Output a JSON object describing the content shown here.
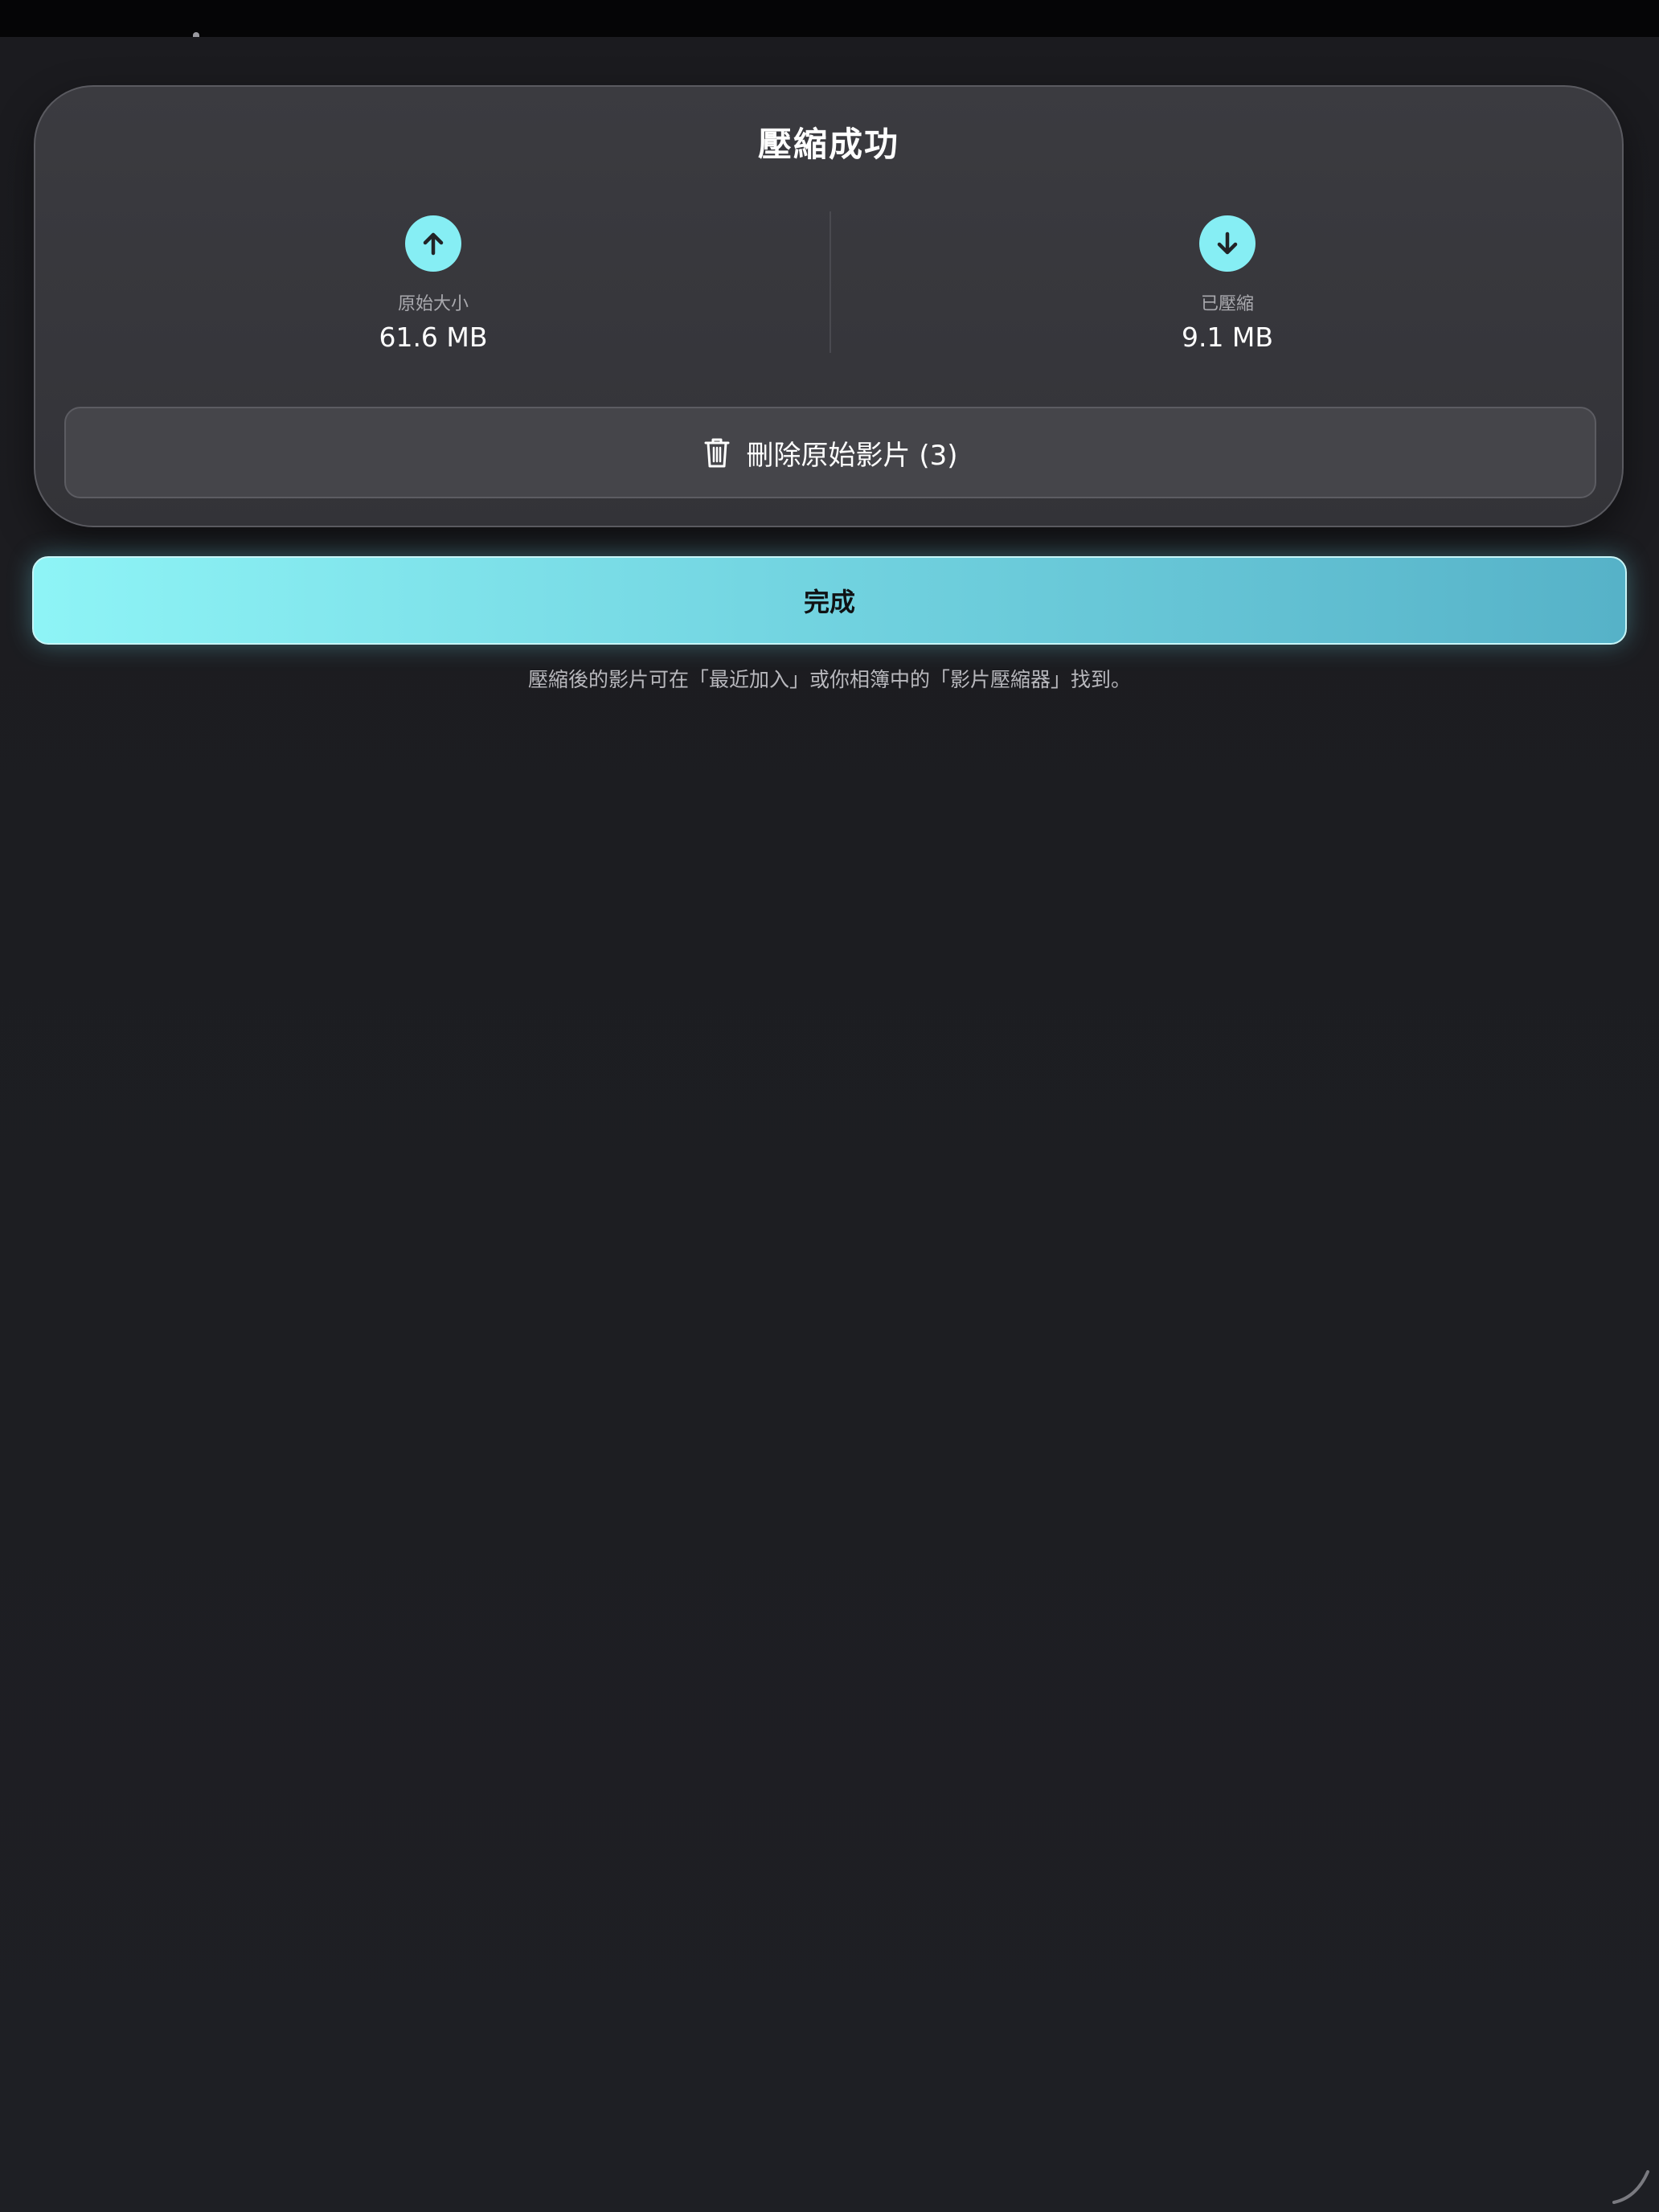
{
  "result": {
    "title": "壓縮成功",
    "original": {
      "label": "原始大小",
      "value": "61.6 MB",
      "icon": "arrow-up-circle-icon"
    },
    "compressed": {
      "label": "已壓縮",
      "value": "9.1 MB",
      "icon": "arrow-down-circle-icon"
    },
    "delete_label": "刪除原始影片 (3)",
    "delete_icon": "trash-icon"
  },
  "done_label": "完成",
  "hint": "壓縮後的影片可在「最近加入」或你相簿中的「影片壓縮器」找到。",
  "colors": {
    "accent": "#86eef4",
    "card_bg": "#38383d",
    "page_bg": "#1c1c20",
    "done_gradient_start": "#8ef4f6",
    "done_gradient_end": "#56b2c8"
  }
}
